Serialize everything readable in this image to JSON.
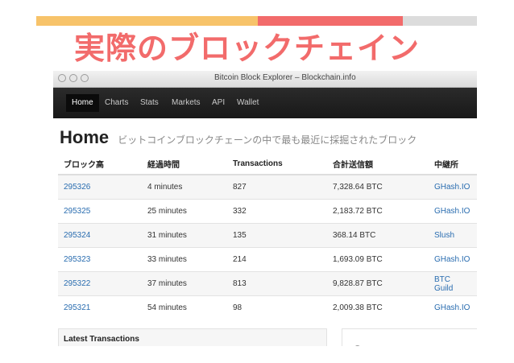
{
  "slide": {
    "title": "実際のブロックチェイン"
  },
  "window": {
    "title": "Bitcoin Block Explorer – Blockchain.info"
  },
  "nav": {
    "items": [
      "Home",
      "Charts",
      "Stats",
      "Markets",
      "API",
      "Wallet"
    ],
    "active": "Home"
  },
  "heading": {
    "main": "Home",
    "sub": "ビットコインブロックチェーンの中で最も最近に採掘されたブロック"
  },
  "table": {
    "headers": [
      "ブロック高",
      "経過時間",
      "Transactions",
      "合計送信額",
      "中継所"
    ],
    "rows": [
      [
        "295326",
        "4 minutes",
        "827",
        "7,328.64 BTC",
        "GHash.IO"
      ],
      [
        "295325",
        "25 minutes",
        "332",
        "2,183.72 BTC",
        "GHash.IO"
      ],
      [
        "295324",
        "31 minutes",
        "135",
        "368.14 BTC",
        "Slush"
      ],
      [
        "295323",
        "33 minutes",
        "214",
        "1,693.09 BTC",
        "GHash.IO"
      ],
      [
        "295322",
        "37 minutes",
        "813",
        "9,828.87 BTC",
        "BTC Guild"
      ],
      [
        "295321",
        "54 minutes",
        "98",
        "2,009.38 BTC",
        "GHash.IO"
      ]
    ]
  },
  "panels": {
    "latest_transactions": "Latest Transactions",
    "right_partial": "Se"
  },
  "colors": {
    "accent_red": "#f26b6b",
    "accent_yellow": "#f7c36a",
    "link_blue": "#2a6db0"
  }
}
